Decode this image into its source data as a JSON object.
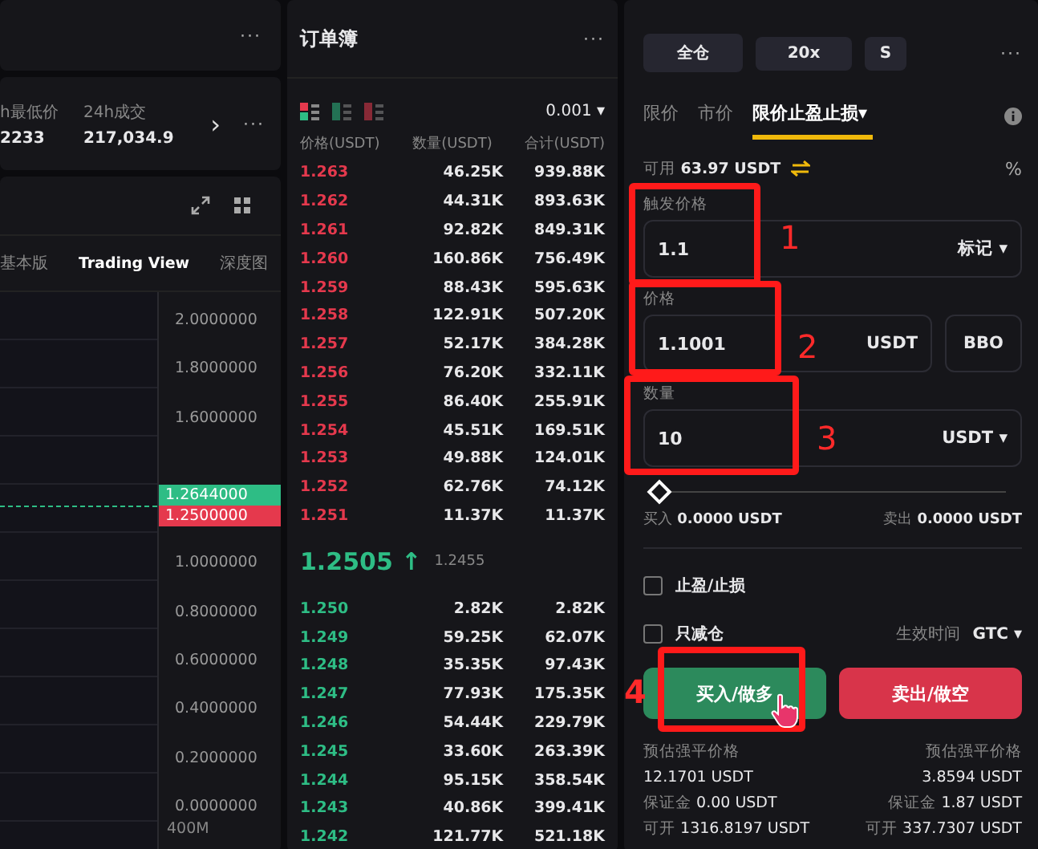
{
  "left": {
    "top_more": "···",
    "stats": [
      {
        "label": "h最低价",
        "value": "2233"
      },
      {
        "label": "24h成交",
        "value": "217,034.9"
      }
    ],
    "next": "›",
    "more": "···",
    "chart_tabs": [
      {
        "label": "基本版",
        "selected": false
      },
      {
        "label": "Trading View",
        "selected": true
      },
      {
        "label": "深度图",
        "selected": false
      }
    ],
    "axis": [
      {
        "kind": "tick",
        "label": "2.0000000"
      },
      {
        "kind": "tick",
        "label": "1.8000000"
      },
      {
        "kind": "tick",
        "label": "1.6000000"
      },
      {
        "kind": "last",
        "label": "1.2644000"
      },
      {
        "kind": "mark",
        "label": "1.2500000"
      },
      {
        "kind": "tick",
        "label": "1.0000000"
      },
      {
        "kind": "tick",
        "label": "0.8000000"
      },
      {
        "kind": "tick",
        "label": "0.6000000"
      },
      {
        "kind": "tick",
        "label": "0.4000000"
      },
      {
        "kind": "tick",
        "label": "0.2000000"
      },
      {
        "kind": "tick",
        "label": "0.0000000"
      }
    ],
    "volume_label": "400M"
  },
  "orderbook": {
    "title": "订单簿",
    "more": "···",
    "views": [
      {
        "kind": "both",
        "selected": true
      },
      {
        "kind": "bids",
        "selected": false
      },
      {
        "kind": "asks",
        "selected": false
      }
    ],
    "precision": "0.001",
    "precision_caret": "▾",
    "columns": [
      "价格(USDT)",
      "数量(USDT)",
      "合计(USDT)"
    ],
    "asks": [
      [
        "1.263",
        "46.25K",
        "939.88K"
      ],
      [
        "1.262",
        "44.31K",
        "893.63K"
      ],
      [
        "1.261",
        "92.82K",
        "849.31K"
      ],
      [
        "1.260",
        "160.86K",
        "756.49K"
      ],
      [
        "1.259",
        "88.43K",
        "595.63K"
      ],
      [
        "1.258",
        "122.91K",
        "507.20K"
      ],
      [
        "1.257",
        "52.17K",
        "384.28K"
      ],
      [
        "1.256",
        "76.20K",
        "332.11K"
      ],
      [
        "1.255",
        "86.40K",
        "255.91K"
      ],
      [
        "1.254",
        "45.51K",
        "169.51K"
      ],
      [
        "1.253",
        "49.88K",
        "124.01K"
      ],
      [
        "1.252",
        "62.76K",
        "74.12K"
      ],
      [
        "1.251",
        "11.37K",
        "11.37K"
      ]
    ],
    "last_price": "1.2505",
    "arrow": "↑",
    "mark_price": "1.2455",
    "bids": [
      [
        "1.250",
        "2.82K",
        "2.82K"
      ],
      [
        "1.249",
        "59.25K",
        "62.07K"
      ],
      [
        "1.248",
        "35.35K",
        "97.43K"
      ],
      [
        "1.247",
        "77.93K",
        "175.35K"
      ],
      [
        "1.246",
        "54.44K",
        "229.79K"
      ],
      [
        "1.245",
        "33.60K",
        "263.39K"
      ],
      [
        "1.244",
        "95.15K",
        "358.54K"
      ],
      [
        "1.243",
        "40.86K",
        "399.41K"
      ],
      [
        "1.242",
        "121.77K",
        "521.18K"
      ]
    ]
  },
  "order": {
    "chips": [
      "全仓",
      "20x",
      "S"
    ],
    "more": "···",
    "types": [
      {
        "label": "限价",
        "selected": false,
        "dropdown": false
      },
      {
        "label": "市价",
        "selected": false,
        "dropdown": false
      },
      {
        "label": "限价止盈止损",
        "selected": true,
        "dropdown": true,
        "caret": "▾"
      }
    ],
    "available_label": "可用",
    "available": "63.97 USDT",
    "percent": "%",
    "trigger": {
      "label": "触发价格",
      "value": "1.1",
      "unit": "标记",
      "caret": "▾"
    },
    "price": {
      "label": "价格",
      "value": "1.1001",
      "unit": "USDT",
      "bbo": "BBO"
    },
    "amount": {
      "label": "数量",
      "value": "10",
      "unit": "USDT",
      "caret": "▾"
    },
    "slider": {
      "level": 0
    },
    "buy_max_label": "买入",
    "buy_max": "0.0000 USDT",
    "sell_max_label": "卖出",
    "sell_max": "0.0000 USDT",
    "options": [
      {
        "label": "止盈/止损",
        "checked": false
      },
      {
        "label": "只减仓",
        "checked": false
      }
    ],
    "tif_label": "生效时间",
    "tif": "GTC",
    "tif_caret": "▾",
    "buy": "买入/做多",
    "sell": "卖出/做空",
    "stats": [
      {
        "kind": "labels",
        "left_label": "预估强平价格",
        "right_label": "预估强平价格"
      },
      {
        "kind": "values",
        "left": "12.1701 USDT",
        "right": "3.8594 USDT"
      },
      {
        "kind": "labeled",
        "left_label": "保证金",
        "left": "0.00 USDT",
        "right_label": "保证金",
        "right": "1.87 USDT"
      },
      {
        "kind": "labeled",
        "left_label": "可开",
        "left": "1316.8197 USDT",
        "right_label": "可开",
        "right": "337.7307 USDT"
      }
    ]
  },
  "annotations": [
    "1",
    "2",
    "3",
    "4"
  ]
}
